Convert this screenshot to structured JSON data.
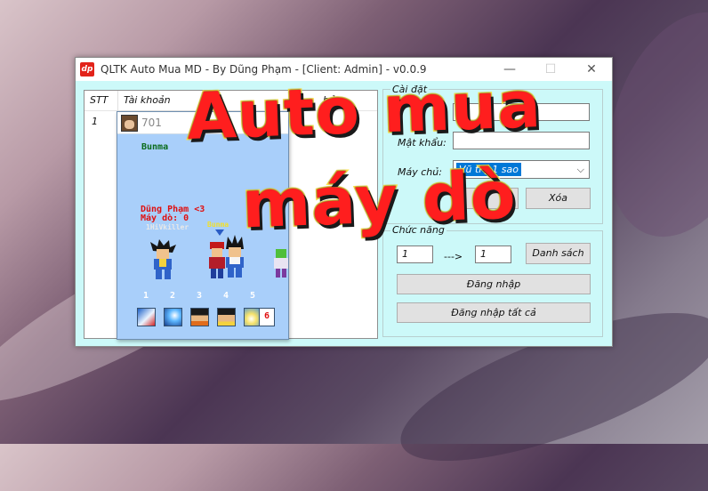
{
  "window": {
    "title": "QLTK Auto Mua MD - By Dũng Phạm - [Client: Admin] - v0.0.9",
    "app_logo": "dp",
    "minimize_glyph": "—",
    "maximize_glyph": "☐",
    "close_glyph": "✕"
  },
  "accounts_list": {
    "columns": [
      "STT",
      "Tài khoản",
      "hủ"
    ],
    "rows": [
      {
        "stt": "1"
      }
    ]
  },
  "game_popup": {
    "account_id": "701",
    "npc_name": "Bunma",
    "player_line1": "Dũng Phạm <3",
    "player_line2": "Máy dò: 0",
    "player_tag": "1HiVkiller",
    "ally_name": "Bunma",
    "skill_numbers": [
      "1",
      "2",
      "3",
      "4",
      "5"
    ],
    "skill_count": "6",
    "icons": [
      "dragon-ball-skill-icon",
      "energy-blast-skill-icon",
      "goku-portrait-icon",
      "vegeta-portrait-icon",
      "kamehameha-skill-icon"
    ]
  },
  "settings": {
    "group_label": "Cài đặt",
    "password_label": "Mật khẩu:",
    "server_label": "Máy chủ:",
    "server_value": "Vũ trụ 1 sao",
    "delete_button": "Xóa"
  },
  "functions": {
    "group_label": "Chức năng",
    "from_value": "1",
    "arrow_label": "--->",
    "to_value": "1",
    "list_button": "Danh sách",
    "login_button": "Đăng nhập",
    "login_all_button": "Đăng nhập tất cả"
  },
  "overlay": {
    "line1": "Auto mua",
    "line2": "máy dò"
  },
  "colors": {
    "client_bg": "#ccf9f9",
    "popup_bg": "#a9cffa",
    "overlay_fill": "#ff1e1e",
    "overlay_stroke": "#ffe64a",
    "selection": "#0078d7"
  }
}
